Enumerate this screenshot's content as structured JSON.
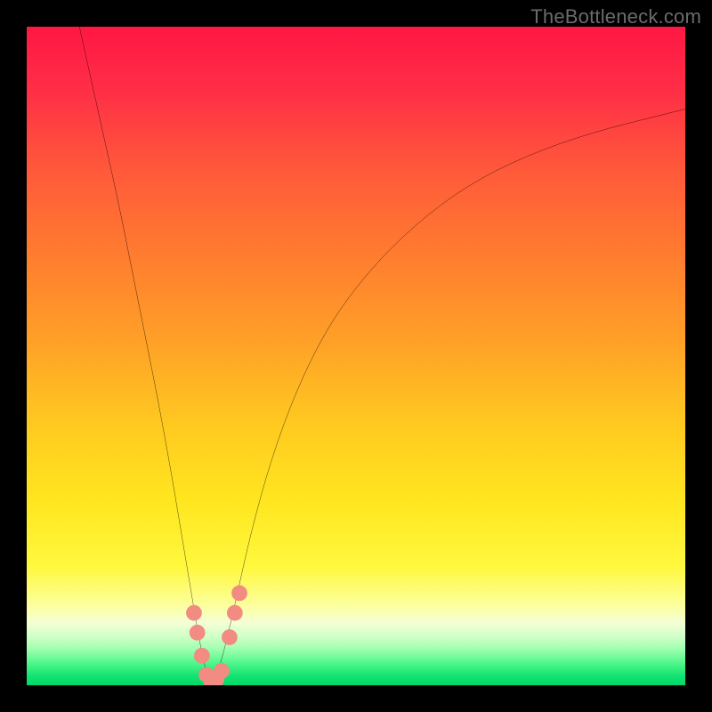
{
  "watermark": "TheBottleneck.com",
  "gradient_stops": [
    {
      "offset": 0.0,
      "color": "#ff1744"
    },
    {
      "offset": 0.1,
      "color": "#ff2f46"
    },
    {
      "offset": 0.22,
      "color": "#ff5a3a"
    },
    {
      "offset": 0.35,
      "color": "#ff7d2f"
    },
    {
      "offset": 0.48,
      "color": "#ffa127"
    },
    {
      "offset": 0.6,
      "color": "#ffc820"
    },
    {
      "offset": 0.72,
      "color": "#ffe61f"
    },
    {
      "offset": 0.82,
      "color": "#fff83e"
    },
    {
      "offset": 0.88,
      "color": "#fcffa0"
    },
    {
      "offset": 0.905,
      "color": "#f4ffd6"
    },
    {
      "offset": 0.925,
      "color": "#d2ffc8"
    },
    {
      "offset": 0.945,
      "color": "#9fffb0"
    },
    {
      "offset": 0.965,
      "color": "#55f78d"
    },
    {
      "offset": 0.985,
      "color": "#15e472"
    },
    {
      "offset": 1.0,
      "color": "#00d968"
    }
  ],
  "chart_data": {
    "type": "line",
    "title": "",
    "xlabel": "",
    "ylabel": "",
    "xlim": [
      0,
      100
    ],
    "ylim": [
      0,
      100
    ],
    "grid": false,
    "legend": false,
    "series": [
      {
        "name": "bottleneck-curve",
        "color": "#000000",
        "x": [
          8,
          10,
          12,
          14,
          16,
          18,
          20,
          22,
          23.5,
          25,
          26,
          26.8,
          27.4,
          28,
          28.6,
          29.4,
          30.4,
          32,
          34,
          37,
          41,
          46,
          52,
          59,
          67,
          76,
          86,
          96,
          100
        ],
        "y": [
          100,
          91,
          82,
          73,
          63,
          53,
          43,
          32,
          23,
          14,
          8,
          4,
          1.5,
          0.4,
          1.2,
          3.2,
          7,
          14,
          23,
          34,
          45,
          55,
          63,
          70,
          76,
          80.5,
          84,
          86.5,
          87.5
        ]
      }
    ],
    "markers": [
      {
        "name": "left-arm-top",
        "x": 25.4,
        "y": 11,
        "color": "#f28b82",
        "r": 1.2
      },
      {
        "name": "left-arm-mid",
        "x": 25.9,
        "y": 8,
        "color": "#f28b82",
        "r": 1.2
      },
      {
        "name": "left-arm-low",
        "x": 26.6,
        "y": 4.5,
        "color": "#f28b82",
        "r": 1.2
      },
      {
        "name": "trough-a",
        "x": 27.3,
        "y": 1.6,
        "color": "#f28b82",
        "r": 1.2
      },
      {
        "name": "trough-b",
        "x": 28.0,
        "y": 0.6,
        "color": "#f28b82",
        "r": 1.2
      },
      {
        "name": "trough-c",
        "x": 28.8,
        "y": 0.9,
        "color": "#f28b82",
        "r": 1.2
      },
      {
        "name": "trough-d",
        "x": 29.6,
        "y": 2.2,
        "color": "#f28b82",
        "r": 1.2
      },
      {
        "name": "right-arm-low",
        "x": 30.8,
        "y": 7.3,
        "color": "#f28b82",
        "r": 1.2
      },
      {
        "name": "right-arm-mid",
        "x": 31.6,
        "y": 11,
        "color": "#f28b82",
        "r": 1.2
      },
      {
        "name": "right-arm-top",
        "x": 32.3,
        "y": 14,
        "color": "#f28b82",
        "r": 1.2
      }
    ]
  }
}
